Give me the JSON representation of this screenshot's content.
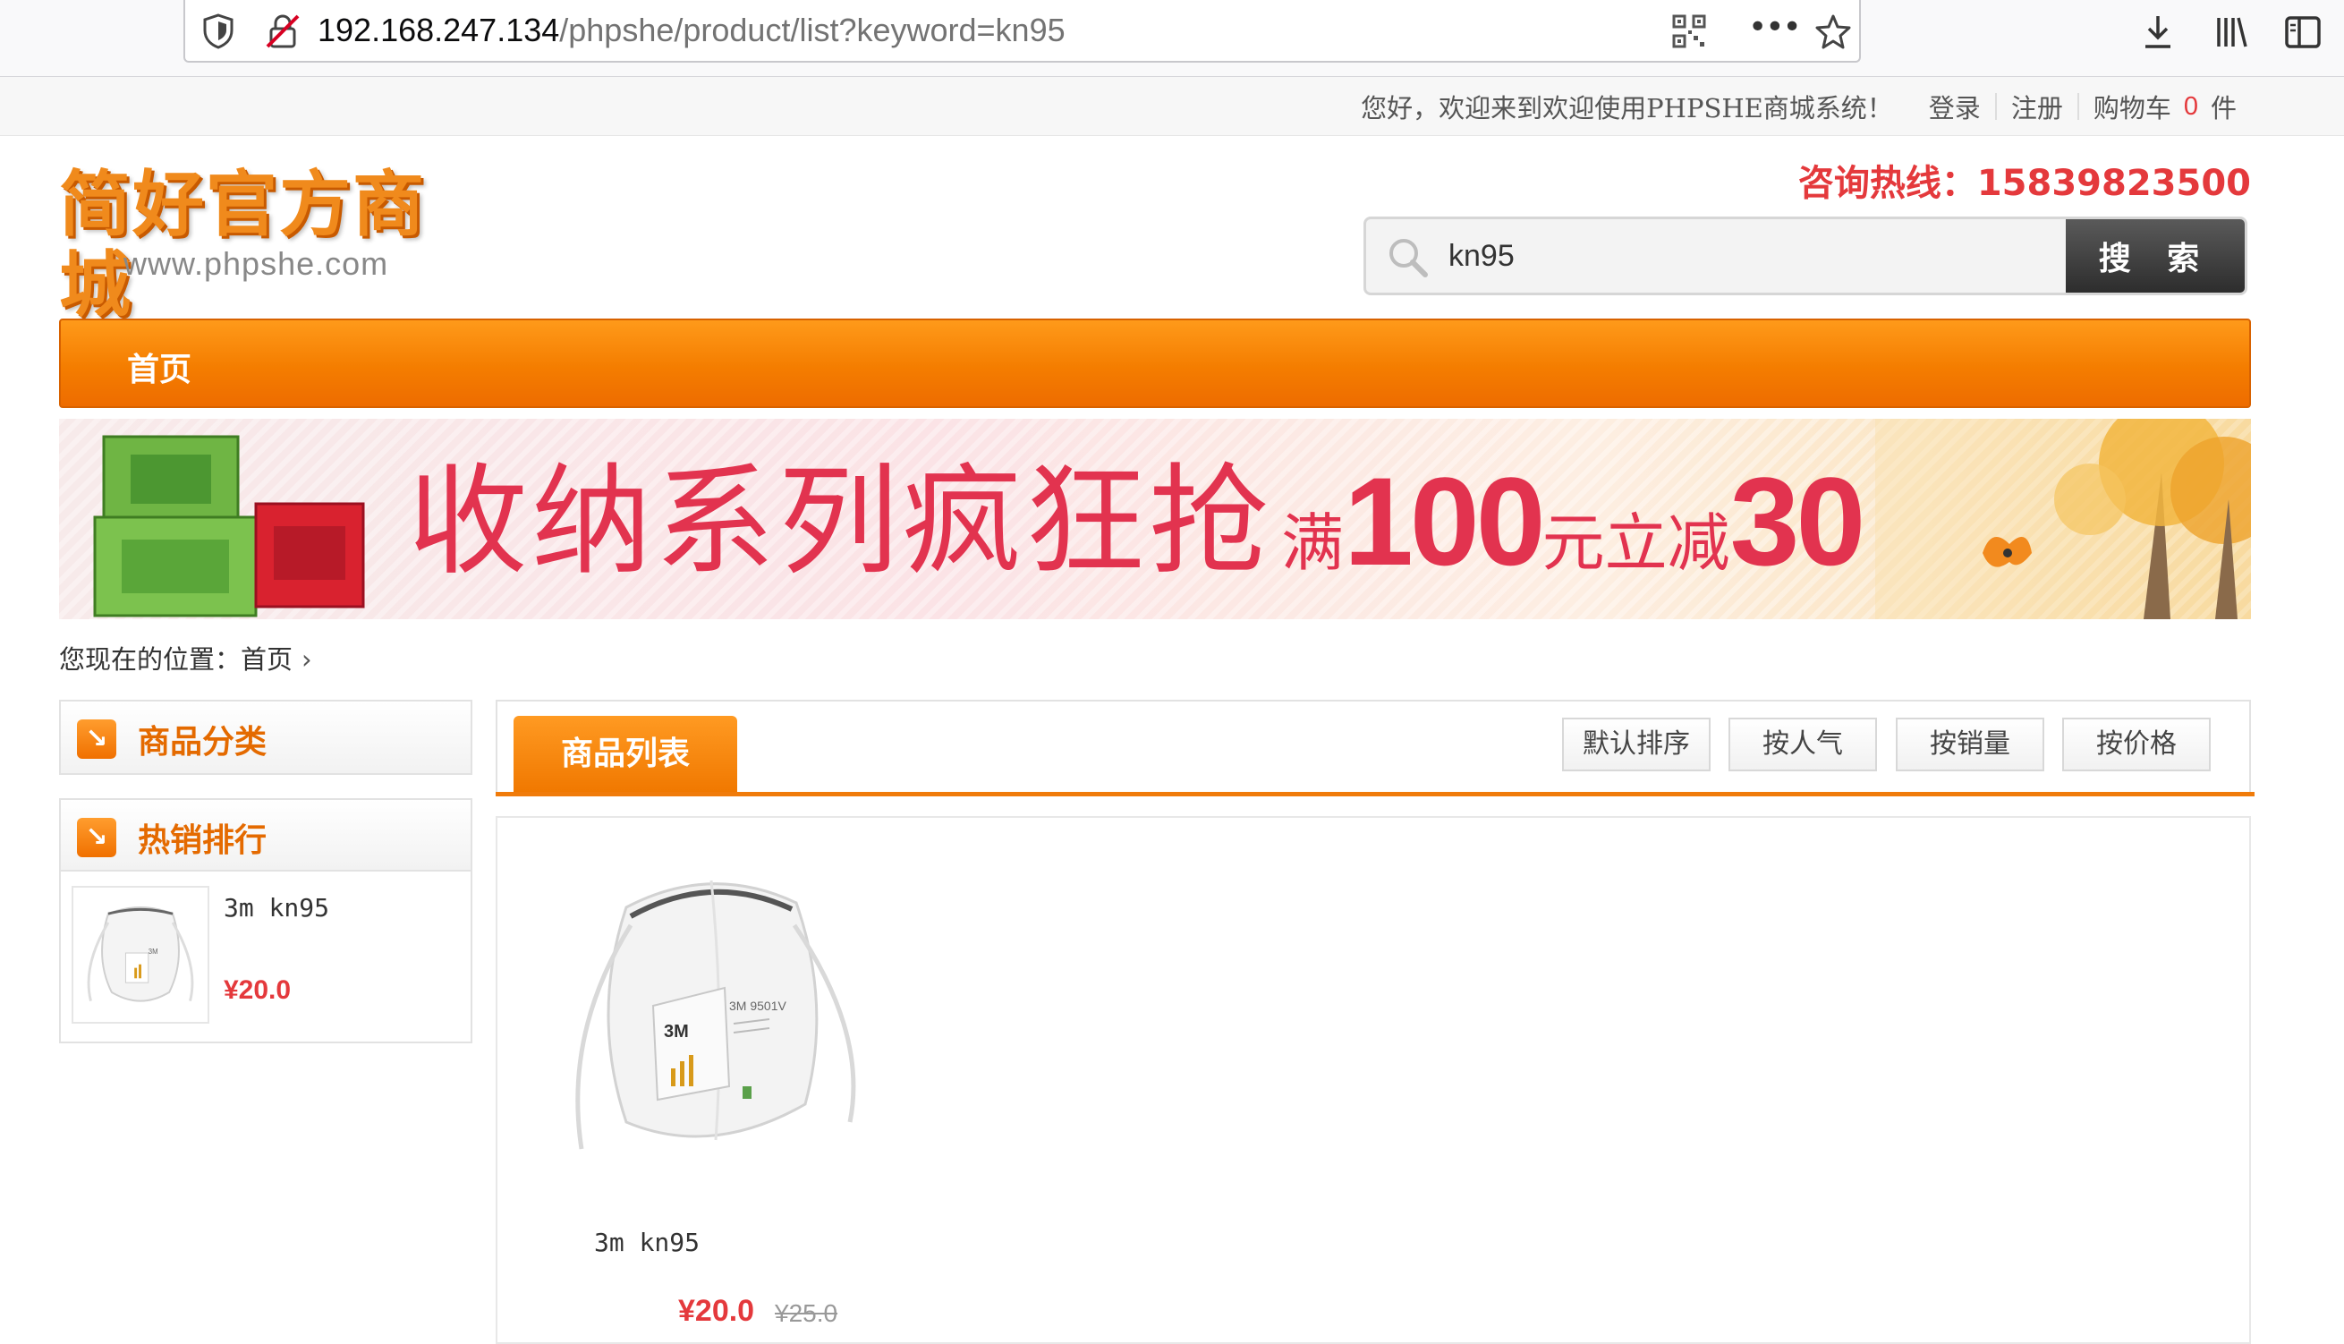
{
  "browser": {
    "url_host": "192.168.247.134",
    "url_path": "/phpshe/product/list?keyword=kn95"
  },
  "topbar": {
    "welcome": "您好，欢迎来到欢迎使用PHPSHE商城系统！",
    "login": "登录",
    "register": "注册",
    "cart_label": "购物车",
    "cart_count": "0",
    "cart_unit": "件"
  },
  "header": {
    "logo_text": "简好官方商城",
    "logo_url": "www.phpshe.com",
    "hotline": "咨询热线：15839823500",
    "search_value": "kn95",
    "search_button": "搜 索"
  },
  "nav": {
    "items": [
      {
        "label": "首页"
      }
    ]
  },
  "banner": {
    "headline": "收纳系列疯狂抢",
    "promo_prefix": "满",
    "promo_amount": "100",
    "promo_mid": "元立减",
    "promo_off": "30"
  },
  "breadcrumb": {
    "label": "您现在的位置：",
    "home": "首页",
    "sep": "›"
  },
  "sidebar": {
    "category_title": "商品分类",
    "hot_title": "热销排行",
    "hot_items": [
      {
        "name": "3m kn95",
        "price": "¥20.0"
      }
    ]
  },
  "list": {
    "tab_label": "商品列表",
    "sort_buttons": [
      "默认排序",
      "按人气",
      "按销量",
      "按价格"
    ],
    "products": [
      {
        "name": "3m kn95",
        "price": "¥20.0",
        "original_price": "¥25.0"
      }
    ]
  },
  "colors": {
    "accent": "#f07b0a",
    "price": "#e4393c"
  }
}
